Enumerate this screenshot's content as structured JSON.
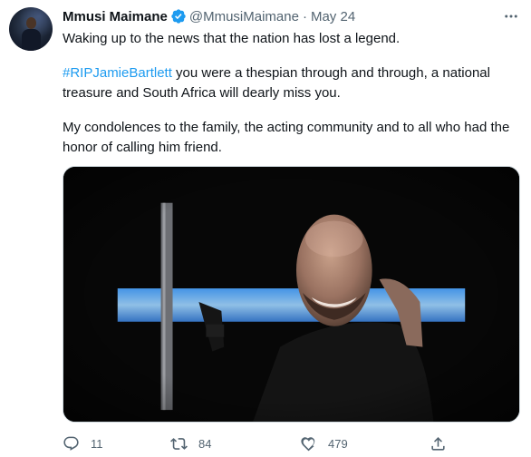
{
  "tweet": {
    "author_name": "Mmusi Maimane",
    "handle": "@MmusiMaimane",
    "separator": "·",
    "date": "May 24",
    "paragraph1": "Waking up to the news that the nation has lost a legend.",
    "hashtag": "#RIPJamieBartlett",
    "paragraph2_rest": " you were a thespian through and through, a national treasure and South Africa will dearly miss you.",
    "paragraph3": "My condolences to the family, the acting community and to all who had the honor of calling him friend."
  },
  "actions": {
    "reply_count": "11",
    "retweet_count": "84",
    "like_count": "479"
  },
  "icons": {
    "verified": "verified-badge-icon",
    "more": "more-options-icon",
    "reply": "reply-icon",
    "retweet": "retweet-icon",
    "like": "like-icon",
    "share": "share-icon"
  },
  "colors": {
    "link": "#1d9bf0",
    "secondary_text": "#536471",
    "primary_text": "#0f1419"
  }
}
